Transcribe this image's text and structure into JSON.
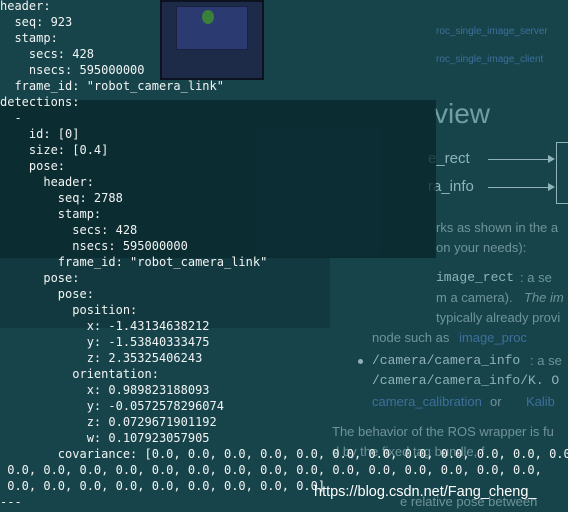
{
  "terminal": {
    "lines": [
      "header:",
      "  seq: 923",
      "  stamp:",
      "    secs: 428",
      "    nsecs: 595000000",
      "  frame_id: \"robot_camera_link\"",
      "detections:",
      "  -",
      "    id: [0]",
      "    size: [0.4]",
      "    pose:",
      "      header:",
      "        seq: 2788",
      "        stamp:",
      "          secs: 428",
      "          nsecs: 595000000",
      "        frame_id: \"robot_camera_link\"",
      "      pose:",
      "        pose:",
      "          position:",
      "            x: -1.43134638212",
      "            y: -1.53840333475",
      "            z: 2.35325406243",
      "          orientation:",
      "            x: 0.989823188093",
      "            y: -0.0572578296074",
      "            z: 0.0729671901192",
      "            w: 0.107923057905",
      "        covariance: [0.0, 0.0, 0.0, 0.0, 0.0, 0.0, 0.0, 0.0, 0.0, 0.0, 0.0, 0.0,",
      " 0.0, 0.0, 0.0, 0.0, 0.0, 0.0, 0.0, 0.0, 0.0, 0.0, 0.0, 0.0, 0.0, 0.0, 0.0,",
      " 0.0, 0.0, 0.0, 0.0, 0.0, 0.0, 0.0, 0.0, 0.0]",
      "---"
    ]
  },
  "background_doc": {
    "links": [
      "roc_single_image_server",
      "roc_single_image_client"
    ],
    "overview_heading": "view",
    "flow_inputs": [
      "e_rect",
      "ra_info"
    ],
    "intro_text_1": "rks as shown in the a",
    "intro_text_2": "on your needs):",
    "bullet1_code": "image_rect",
    "bullet1_rest": ": a se",
    "bullet1_line2a": "m a camera). ",
    "bullet1_line2b": "The im",
    "bullet1_line3": "typically already provi",
    "bullet1_line4a": "node such as ",
    "bullet1_line4b": "image_proc",
    "bullet2_code": "/camera/camera_info",
    "bullet2_rest": ": a se",
    "bullet2_line2": "/camera/camera_info/K. O",
    "bullet2_line3a": "camera_calibration",
    "bullet2_line3b": " or ",
    "bullet2_line3c": "Kalib",
    "para_text_1": "The behavior of the ROS wrapper is fu",
    "para_text_2": "d by the fixed tag bundle, f",
    "para_text_3": "e relative pose between"
  },
  "watermark": "https://blog.csdn.net/Fang_cheng_",
  "colors": {
    "terminal_bg": "#0e3a40",
    "terminal_text": "#f2f4f4",
    "doc_link": "#3d6f9a"
  }
}
